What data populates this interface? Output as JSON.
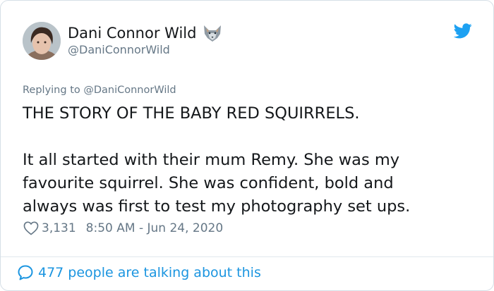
{
  "author": {
    "display_name": "Dani Connor Wild",
    "handle": "@DaniConnorWild",
    "name_emoji": "wolf-icon",
    "avatar": "avatar"
  },
  "reply": {
    "label": "Replying to @DaniConnorWild"
  },
  "tweet": {
    "paragraph_1": "THE STORY OF THE BABY RED SQUIRRELS.",
    "paragraph_2": "It all started with their mum Remy. She was my\nfavourite squirrel. She was confident, bold and\nalways was first to test my photography set ups.",
    "likes": "3,131",
    "timestamp": "8:50 AM - Jun 24, 2020"
  },
  "footer": {
    "talking": "477 people are talking about this"
  },
  "colors": {
    "accent": "#1da1f2",
    "link": "#1b95e0",
    "muted": "#657786"
  }
}
